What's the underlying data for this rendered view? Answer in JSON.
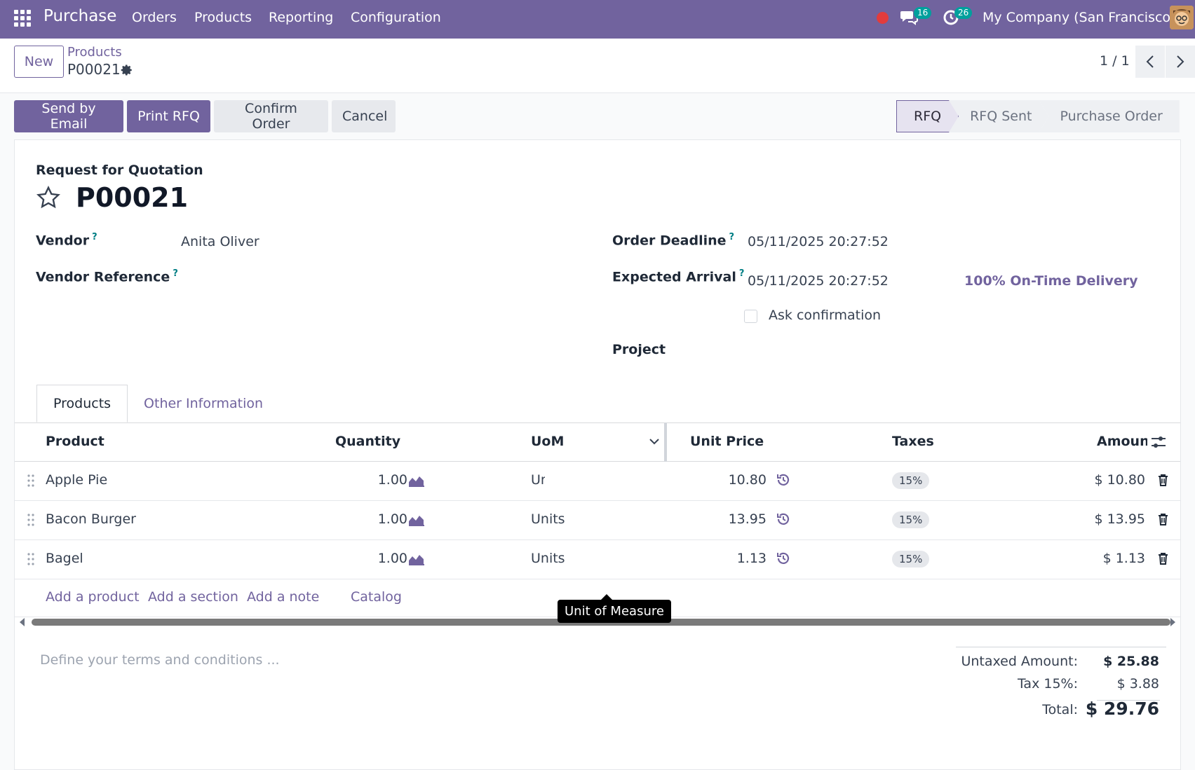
{
  "topbar": {
    "app_name": "Purchase",
    "menu": [
      "Orders",
      "Products",
      "Reporting",
      "Configuration"
    ],
    "messages_count": "16",
    "activities_count": "26",
    "company": "My Company (San Francisco)"
  },
  "control": {
    "new_label": "New",
    "breadcrumb_parent": "Products",
    "breadcrumb_current": "P00021",
    "pager": "1 / 1"
  },
  "actions": {
    "send_email": "Send by Email",
    "print_rfq": "Print RFQ",
    "confirm_order": "Confirm Order",
    "cancel": "Cancel"
  },
  "statusbar": [
    "RFQ",
    "RFQ Sent",
    "Purchase Order"
  ],
  "form": {
    "doc_type": "Request for Quotation",
    "name": "P00021",
    "vendor_label": "Vendor",
    "vendor_value": "Anita Oliver",
    "vendor_ref_label": "Vendor Reference",
    "deadline_label": "Order Deadline",
    "deadline_value": "05/11/2025 20:27:52",
    "arrival_label": "Expected Arrival",
    "arrival_value": "05/11/2025 20:27:52",
    "ontime": "100% On-Time Delivery",
    "ask_confirmation": "Ask confirmation",
    "project_label": "Project",
    "help_mark": "?"
  },
  "tabs": [
    "Products",
    "Other Information"
  ],
  "table": {
    "headers": [
      "Product",
      "Quantity",
      "UoM",
      "Unit Price",
      "Taxes",
      "Amount"
    ],
    "rows": [
      {
        "product": "Apple Pie",
        "qty": "1.00",
        "uom": "Units",
        "price": "10.80",
        "tax": "15%",
        "amount": "$ 10.80"
      },
      {
        "product": "Bacon Burger",
        "qty": "1.00",
        "uom": "Units",
        "price": "13.95",
        "tax": "15%",
        "amount": "$ 13.95"
      },
      {
        "product": "Bagel",
        "qty": "1.00",
        "uom": "Units",
        "price": "1.13",
        "tax": "15%",
        "amount": "$ 1.13"
      }
    ],
    "add_product": "Add a product",
    "add_section": "Add a section",
    "add_note": "Add a note",
    "catalog": "Catalog",
    "tooltip": "Unit of Measure"
  },
  "footer": {
    "terms_placeholder": "Define your terms and conditions ...",
    "untaxed_label": "Untaxed Amount:",
    "untaxed_value": "$ 25.88",
    "tax_label": "Tax 15%:",
    "tax_value": "$ 3.88",
    "total_label": "Total:",
    "total_value": "$ 29.76"
  }
}
